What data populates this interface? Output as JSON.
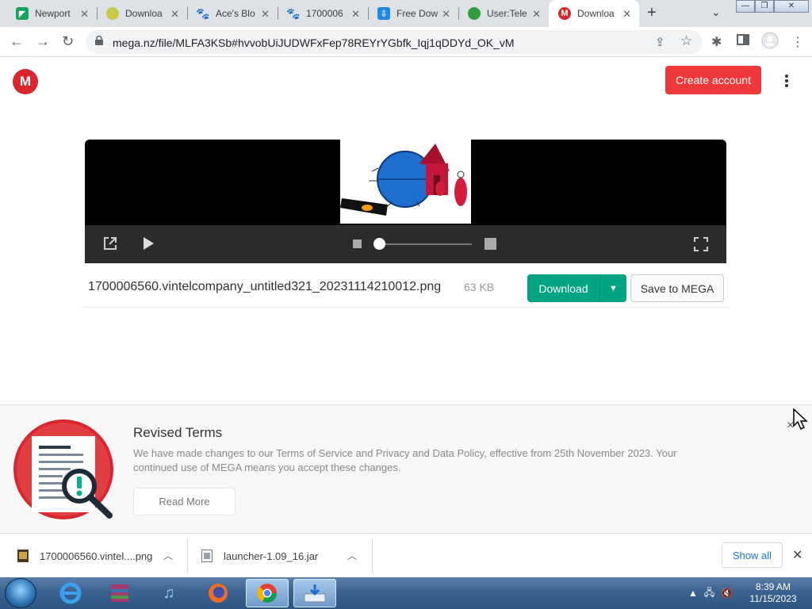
{
  "browser": {
    "tabs": [
      {
        "label": "Newport",
        "icon": "green-flag-favicon",
        "color": "#1aa260"
      },
      {
        "label": "Downloa",
        "icon": "globe-favicon",
        "color": "#a8b52d"
      },
      {
        "label": "Ace's Blo",
        "icon": "paw-favicon",
        "color": "#111111"
      },
      {
        "label": "1700006",
        "icon": "paw-favicon",
        "color": "#111111"
      },
      {
        "label": "Free Dow",
        "icon": "download-favicon",
        "color": "#1e88e5"
      },
      {
        "label": "User:Tele",
        "icon": "wiki-favicon",
        "color": "#2e9e3e"
      },
      {
        "label": "Downloa",
        "icon": "mega-favicon",
        "color": "#d9272e",
        "active": true
      }
    ],
    "url": "mega.nz/file/MLFA3KSb#hvvobUiJUDWFxFep78REYrYGbfk_Iqj1qDDYd_OK_vM"
  },
  "mega": {
    "logo_letter": "M",
    "create_account": "Create account",
    "file_name": "1700006560.vintelcompany_untitled321_20231114210012.png",
    "file_size": "63 KB",
    "download_label": "Download",
    "save_label": "Save to MEGA",
    "brand_red": "#d9272e",
    "download_green": "#00a382"
  },
  "terms": {
    "title": "Revised Terms",
    "body": "We have made changes to our Terms of Service and Privacy and Data Policy, effective from 25th November 2023. Your continued use of MEGA means you accept these changes.",
    "read_more": "Read More",
    "close": "×"
  },
  "downloads": {
    "items": [
      {
        "name": "1700006560.vintel....png"
      },
      {
        "name": "launcher-1.09_16.jar"
      }
    ],
    "show_all": "Show all"
  },
  "taskbar": {
    "time": "8:39 AM",
    "date": "11/15/2023"
  }
}
